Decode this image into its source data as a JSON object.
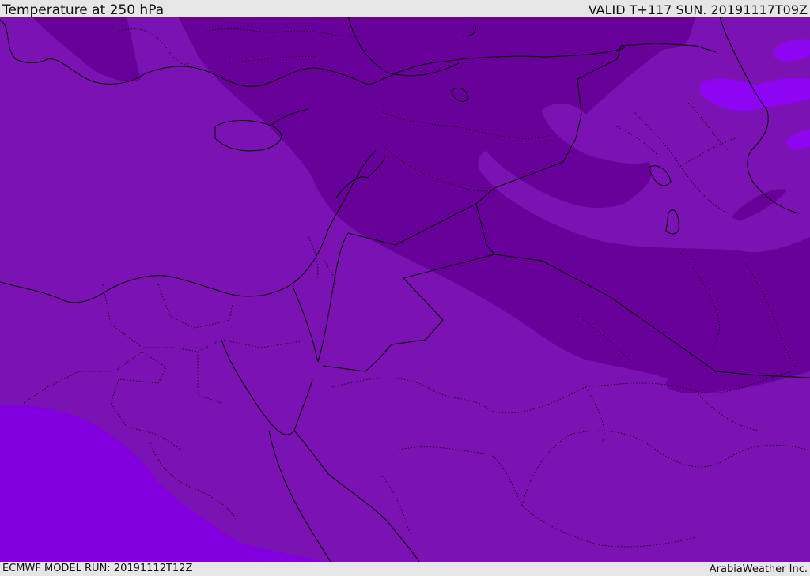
{
  "header": {
    "title": "Temperature at 250 hPa",
    "valid": "VALID T+117 SUN. 20191117T09Z"
  },
  "footer": {
    "model_run": "ECMWF MODEL RUN: 20191112T12Z",
    "credit": "ArabiaWeather Inc."
  },
  "colors": {
    "base_field": "#7b12b3",
    "cold_band": "#680199",
    "warm_pocket": "#8200df",
    "warm_patch": "#8d05f2",
    "boundary_line": "#000000",
    "frame_bg": "#e6e6e6"
  }
}
